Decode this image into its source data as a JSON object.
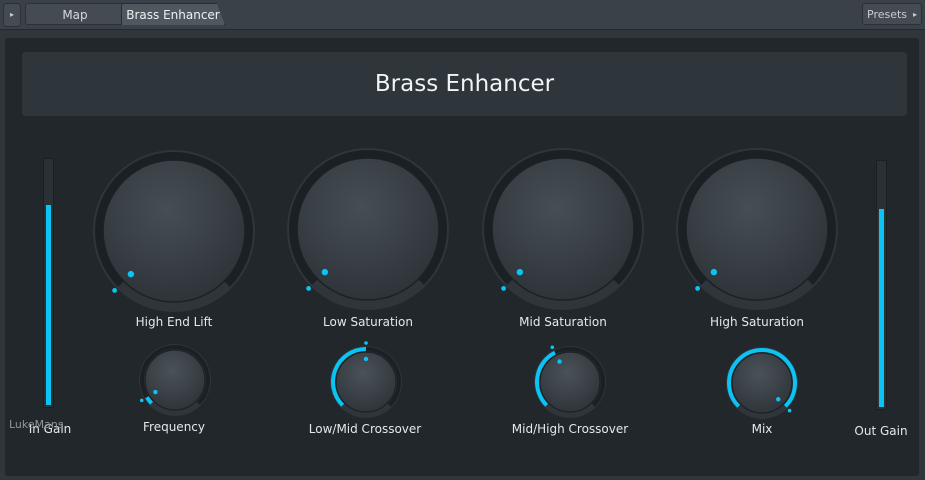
{
  "tabs": {
    "map_label": "Map",
    "active_label": "Brass Enhancer",
    "presets_label": "Presets"
  },
  "plugin": {
    "title": "Brass Enhancer",
    "brand": "LukeMans",
    "accent_color": "#0cc4f4"
  },
  "meters": {
    "in_gain": {
      "label": "In Gain",
      "level": 0.82
    },
    "out_gain": {
      "label": "Out Gain",
      "level": 0.81
    }
  },
  "knobs": {
    "high_end_lift": {
      "label": "High End Lift",
      "value": 0.0
    },
    "low_saturation": {
      "label": "Low Saturation",
      "value": 0.0
    },
    "mid_saturation": {
      "label": "Mid Saturation",
      "value": 0.0
    },
    "high_saturation": {
      "label": "High Saturation",
      "value": 0.0
    },
    "frequency": {
      "label": "Frequency",
      "value": 0.05
    },
    "low_mid_crossover": {
      "label": "Low/Mid Crossover",
      "value": 0.5
    },
    "mid_high_crossover": {
      "label": "Mid/High Crossover",
      "value": 0.4
    },
    "mix": {
      "label": "Mix",
      "value": 1.0
    }
  }
}
